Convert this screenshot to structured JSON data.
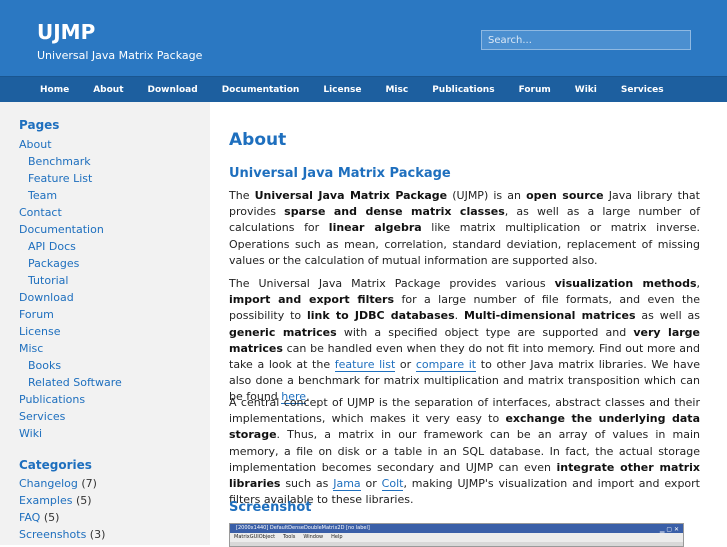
{
  "header": {
    "title": "UJMP",
    "subtitle": "Universal Java Matrix Package",
    "search_placeholder": "Search..."
  },
  "nav": [
    "Home",
    "About",
    "Download",
    "Documentation",
    "License",
    "Misc",
    "Publications",
    "Forum",
    "Wiki",
    "Services"
  ],
  "sidebar": {
    "pages_heading": "Pages",
    "pages": [
      {
        "label": "About",
        "sub": false
      },
      {
        "label": "Benchmark",
        "sub": true
      },
      {
        "label": "Feature List",
        "sub": true
      },
      {
        "label": "Team",
        "sub": true
      },
      {
        "label": "Contact",
        "sub": false
      },
      {
        "label": "Documentation",
        "sub": false
      },
      {
        "label": "API Docs",
        "sub": true
      },
      {
        "label": "Packages",
        "sub": true
      },
      {
        "label": "Tutorial",
        "sub": true
      },
      {
        "label": "Download",
        "sub": false
      },
      {
        "label": "Forum",
        "sub": false
      },
      {
        "label": "License",
        "sub": false
      },
      {
        "label": "Misc",
        "sub": false
      },
      {
        "label": "Books",
        "sub": true
      },
      {
        "label": "Related Software",
        "sub": true
      },
      {
        "label": "Publications",
        "sub": false
      },
      {
        "label": "Services",
        "sub": false
      },
      {
        "label": "Wiki",
        "sub": false
      }
    ],
    "categories_heading": "Categories",
    "categories": [
      {
        "label": "Changelog",
        "count": "(7)"
      },
      {
        "label": "Examples",
        "count": "(5)"
      },
      {
        "label": "FAQ",
        "count": "(5)"
      },
      {
        "label": "Screenshots",
        "count": "(3)"
      }
    ]
  },
  "main": {
    "page_title": "About",
    "section1": "Universal Java Matrix Package",
    "p1": [
      {
        "t": "The "
      },
      {
        "t": "Universal Java Matrix Package",
        "b": true
      },
      {
        "t": " (UJMP) is an "
      },
      {
        "t": "open source",
        "b": true
      },
      {
        "t": " Java library that provides "
      },
      {
        "t": "sparse and dense matrix classes",
        "b": true
      },
      {
        "t": ", as well as a large number of calculations for "
      },
      {
        "t": "linear algebra",
        "b": true
      },
      {
        "t": " like matrix multiplication or matrix inverse. Operations such as mean, correlation, standard deviation, replacement of missing values or the calculation of mutual information are supported also."
      }
    ],
    "p2": [
      {
        "t": "The Universal Java Matrix Package provides various "
      },
      {
        "t": "visualization methods",
        "b": true
      },
      {
        "t": ", "
      },
      {
        "t": "import and export filters",
        "b": true
      },
      {
        "t": " for a large number of file formats, and even the possibility to "
      },
      {
        "t": "link to JDBC databases",
        "b": true
      },
      {
        "t": ". "
      },
      {
        "t": "Multi-dimensional matrices",
        "b": true
      },
      {
        "t": " as well as "
      },
      {
        "t": "generic matrices",
        "b": true
      },
      {
        "t": " with a specified object type are supported and "
      },
      {
        "t": "very large matrices",
        "b": true
      },
      {
        "t": " can be handled even when they do not fit into memory. Find out more and take a look at the "
      },
      {
        "t": "feature list",
        "link": true
      },
      {
        "t": " or "
      },
      {
        "t": "compare it",
        "link": true
      },
      {
        "t": " to other Java matrix libraries. We have also done a benchmark for matrix multiplication and matrix transposition which can be found "
      },
      {
        "t": "here",
        "link": true
      },
      {
        "t": "."
      }
    ],
    "p3": [
      {
        "t": "A central concept of UJMP is the separation of interfaces, abstract classes and their implementations, which makes it very easy to "
      },
      {
        "t": "exchange the underlying data storage",
        "b": true
      },
      {
        "t": ". Thus, a matrix in our framework can be an array of values in main memory, a file on disk or a table in an SQL database. In fact, the actual storage implementation becomes secondary and UJMP can even "
      },
      {
        "t": "integrate other matrix libraries",
        "b": true
      },
      {
        "t": " such as "
      },
      {
        "t": "Jama",
        "link": true
      },
      {
        "t": " or "
      },
      {
        "t": "Colt",
        "link": true
      },
      {
        "t": ", making UJMP's visualization and import and export filters available to these libraries."
      }
    ],
    "section2": "Screenshot",
    "screenshot": {
      "window_title": "[2000x1440] DefaultDenseDoubleMatrix2D [no label]",
      "menu": [
        "MatrixGUIObject",
        "Tools",
        "Window",
        "Help"
      ]
    }
  },
  "colors": {
    "header_bg": "#2b78c2",
    "nav_bg": "#1d5f9f",
    "link": "#1e6fbe",
    "sidebar_bg": "#f2f2f2"
  }
}
